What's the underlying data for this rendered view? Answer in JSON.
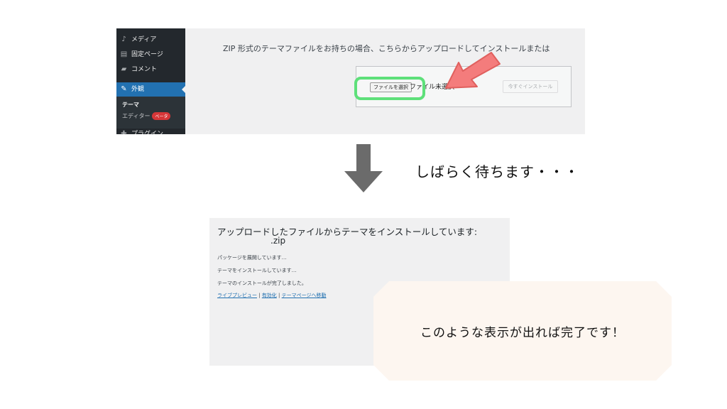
{
  "sidebar": {
    "items": [
      {
        "icon": "media-icon",
        "glyph": "♪",
        "label": "メディア"
      },
      {
        "icon": "pages-icon",
        "glyph": "▤",
        "label": "固定ページ"
      },
      {
        "icon": "comments-icon",
        "glyph": "▰",
        "label": "コメント"
      }
    ],
    "active": {
      "icon": "brush-icon",
      "glyph": "✎",
      "label": "外観"
    },
    "submenu": {
      "theme": "テーマ",
      "editor": "エディター",
      "beta": "ベータ"
    },
    "next": {
      "icon": "plugins-icon",
      "glyph": "✚",
      "label": "プラグイン"
    }
  },
  "upload": {
    "description": "ZIP 形式のテーマファイルをお持ちの場合、こちらからアップロードしてインストールまたは",
    "choose_file": "ファイルを選択",
    "no_file": "ファイル未選択",
    "install_now": "今すぐインストール"
  },
  "wait_text": "しばらく待ちます・・・",
  "install": {
    "title": "アップロードしたファイルからテーマをインストールしています:",
    "file": ".zip",
    "log": [
      "パッケージを展開しています…",
      "テーマをインストールしています…",
      "テーマのインストールが完了しました。"
    ],
    "actions": {
      "preview": "ライブプレビュー",
      "sep": " | ",
      "activate": "有効化",
      "theme_page": "テーマページへ移動"
    }
  },
  "done_text": "このような表示が出れば完了です！",
  "colors": {
    "arrow": "#f47c7c",
    "ring": "#5ee07a",
    "down_arrow": "#6b6b6b",
    "callout": "#fdf6f0",
    "sidebar": "#23282d",
    "active": "#2271b1"
  }
}
